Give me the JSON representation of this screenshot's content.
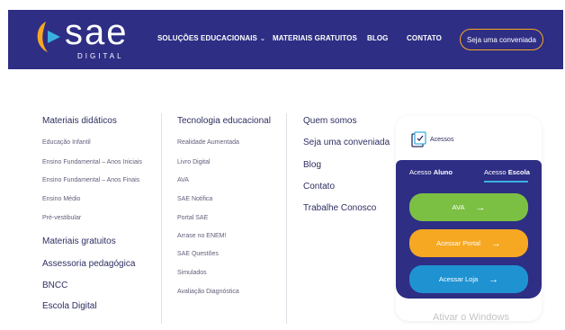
{
  "header": {
    "logo_word": "sae",
    "logo_sub": "DIGITAL",
    "nav": [
      {
        "label": "SOLUÇÕES EDUCACIONAIS",
        "has_chevron": true
      },
      {
        "label": "MATERIAIS GRATUITOS"
      },
      {
        "label": "BLOG"
      },
      {
        "label": "CONTATO"
      }
    ],
    "cta_label": "Seja uma conveniada"
  },
  "menu": {
    "col1": {
      "title": "Materiais didáticos",
      "links": [
        "Educação Infantil",
        "Ensino Fundamental – Anos Iniciais",
        "Ensino Fundamental – Anos Finais",
        "Ensino Médio",
        "Pré-vestibular"
      ],
      "extra_titles": [
        "Materiais gratuitos",
        "Assessoria pedagógica",
        "BNCC",
        "Escola Digital"
      ]
    },
    "col2": {
      "title": "Tecnologia educacional",
      "links": [
        "Realidade Aumentada",
        "Livro Digital",
        "AVA",
        "SAE Notifica",
        "Portal SAE",
        "Arrase no ENEM!",
        "SAE Questões",
        "Simulados",
        "Avaliação Diagnóstica"
      ]
    },
    "col3": {
      "links": [
        "Quem somos",
        "Seja uma conveniada",
        "Blog",
        "Contato",
        "Trabalhe Conosco"
      ]
    }
  },
  "access": {
    "title": "Acessos",
    "tab_aluno_prefix": "Acesso ",
    "tab_aluno_em": "Aluno",
    "tab_escola_prefix": "Acesso ",
    "tab_escola_em": "Escola",
    "active_tab": "Escola",
    "buttons": [
      {
        "label": "AVA",
        "color": "#7cc043"
      },
      {
        "label": "Acessar Portal",
        "color": "#f7a823"
      },
      {
        "label": "Acessar Loja",
        "color": "#1f93d1"
      }
    ],
    "arrow": "→"
  },
  "watermark": "Ativar o Windows",
  "colors": {
    "header_bg": "#2e2e85",
    "accent_orange": "#f7a823",
    "accent_blue": "#3ab0e0",
    "text_dark": "#2e2e62"
  }
}
